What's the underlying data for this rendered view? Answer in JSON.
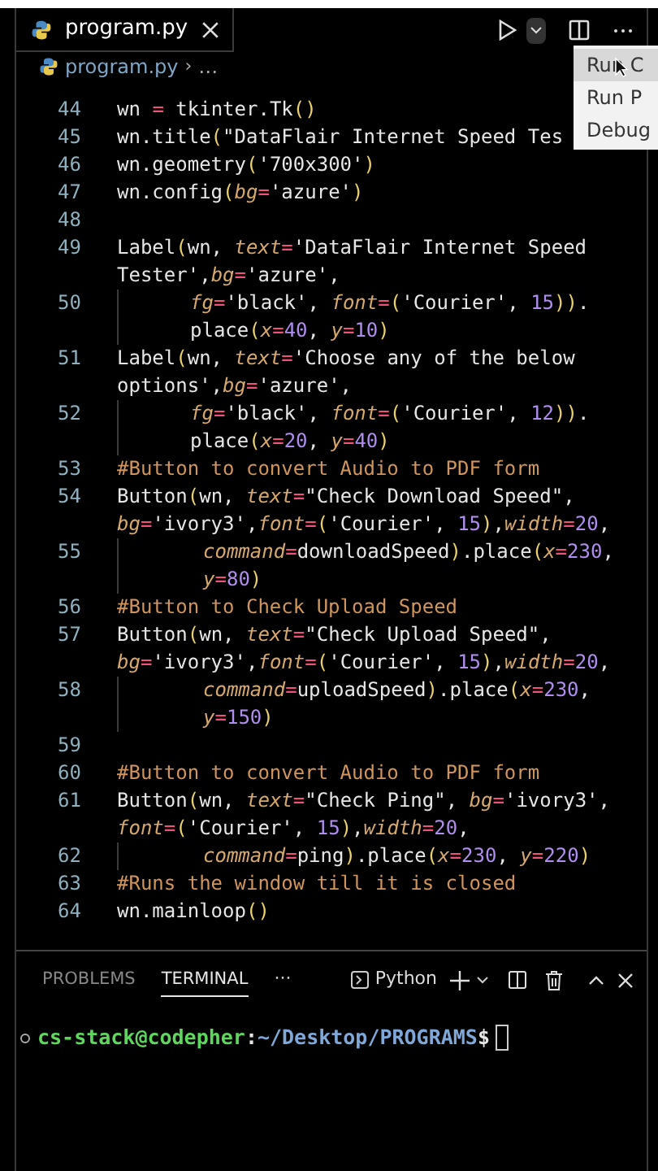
{
  "editor_tab": {
    "label": "program.py",
    "selected": true
  },
  "breadcrumb": {
    "file": "program.py",
    "separator": "›",
    "rest": "…"
  },
  "run_menu": {
    "items": [
      {
        "label": "Run C",
        "selected": true
      },
      {
        "label": "Run P",
        "selected": false
      },
      {
        "label": "Debug",
        "selected": false
      }
    ]
  },
  "code_rows": [
    {
      "number": "44",
      "kind": "line",
      "tokens": [
        {
          "kind": "plain",
          "text": "wn "
        },
        {
          "kind": "operator",
          "text": "="
        },
        {
          "kind": "plain",
          "text": " tkinter.Tk"
        },
        {
          "kind": "bracket",
          "text": "()"
        }
      ]
    },
    {
      "number": "45",
      "kind": "line",
      "tokens": [
        {
          "kind": "plain",
          "text": "wn.title"
        },
        {
          "kind": "bracket",
          "text": "("
        },
        {
          "kind": "string",
          "text": "\"DataFlair Internet Speed Tes"
        }
      ]
    },
    {
      "number": "46",
      "kind": "line",
      "tokens": [
        {
          "kind": "plain",
          "text": "wn.geometry"
        },
        {
          "kind": "bracket",
          "text": "("
        },
        {
          "kind": "string",
          "text": "'700x300'"
        },
        {
          "kind": "bracket",
          "text": ")"
        }
      ]
    },
    {
      "number": "47",
      "kind": "line",
      "tokens": [
        {
          "kind": "plain",
          "text": "wn.config"
        },
        {
          "kind": "bracket",
          "text": "("
        },
        {
          "kind": "keyword",
          "text": "bg"
        },
        {
          "kind": "operator",
          "text": "="
        },
        {
          "kind": "string",
          "text": "'azure'"
        },
        {
          "kind": "bracket",
          "text": ")"
        }
      ]
    },
    {
      "number": "48",
      "kind": "line",
      "tokens": []
    },
    {
      "number": "49",
      "kind": "line",
      "tokens": [
        {
          "kind": "plain",
          "text": "Label"
        },
        {
          "kind": "bracket",
          "text": "("
        },
        {
          "kind": "plain",
          "text": "wn, "
        },
        {
          "kind": "keyword",
          "text": "text"
        },
        {
          "kind": "operator",
          "text": "="
        },
        {
          "kind": "string",
          "text": "'DataFlair Internet Speed"
        }
      ]
    },
    {
      "kind": "wrap",
      "tokens": [
        {
          "kind": "string",
          "text": "Tester'"
        },
        {
          "kind": "plain",
          "text": ","
        },
        {
          "kind": "keyword",
          "text": "bg"
        },
        {
          "kind": "operator",
          "text": "="
        },
        {
          "kind": "string",
          "text": "'azure'"
        },
        {
          "kind": "plain",
          "text": ","
        }
      ]
    },
    {
      "number": "50",
      "kind": "indented",
      "tokens": [
        {
          "kind": "keyword",
          "text": "fg"
        },
        {
          "kind": "operator",
          "text": "="
        },
        {
          "kind": "string",
          "text": "'black'"
        },
        {
          "kind": "plain",
          "text": ", "
        },
        {
          "kind": "keyword",
          "text": "font"
        },
        {
          "kind": "operator",
          "text": "="
        },
        {
          "kind": "bracket",
          "text": "("
        },
        {
          "kind": "string",
          "text": "'Courier'"
        },
        {
          "kind": "plain",
          "text": ", "
        },
        {
          "kind": "number",
          "text": "15"
        },
        {
          "kind": "bracket",
          "text": "))"
        },
        {
          "kind": "plain",
          "text": "."
        }
      ]
    },
    {
      "kind": "indented",
      "tokens": [
        {
          "kind": "plain",
          "text": "place"
        },
        {
          "kind": "bracket",
          "text": "("
        },
        {
          "kind": "keyword",
          "text": "x"
        },
        {
          "kind": "operator",
          "text": "="
        },
        {
          "kind": "number",
          "text": "40"
        },
        {
          "kind": "plain",
          "text": ", "
        },
        {
          "kind": "keyword",
          "text": "y"
        },
        {
          "kind": "operator",
          "text": "="
        },
        {
          "kind": "number",
          "text": "10"
        },
        {
          "kind": "bracket",
          "text": ")"
        }
      ]
    },
    {
      "number": "51",
      "kind": "line",
      "tokens": [
        {
          "kind": "plain",
          "text": "Label"
        },
        {
          "kind": "bracket",
          "text": "("
        },
        {
          "kind": "plain",
          "text": "wn, "
        },
        {
          "kind": "keyword",
          "text": "text"
        },
        {
          "kind": "operator",
          "text": "="
        },
        {
          "kind": "string",
          "text": "'Choose any of the below"
        }
      ]
    },
    {
      "kind": "wrap",
      "tokens": [
        {
          "kind": "string",
          "text": "options'"
        },
        {
          "kind": "plain",
          "text": ","
        },
        {
          "kind": "keyword",
          "text": "bg"
        },
        {
          "kind": "operator",
          "text": "="
        },
        {
          "kind": "string",
          "text": "'azure'"
        },
        {
          "kind": "plain",
          "text": ","
        }
      ]
    },
    {
      "number": "52",
      "kind": "indented",
      "tokens": [
        {
          "kind": "keyword",
          "text": "fg"
        },
        {
          "kind": "operator",
          "text": "="
        },
        {
          "kind": "string",
          "text": "'black'"
        },
        {
          "kind": "plain",
          "text": ", "
        },
        {
          "kind": "keyword",
          "text": "font"
        },
        {
          "kind": "operator",
          "text": "="
        },
        {
          "kind": "bracket",
          "text": "("
        },
        {
          "kind": "string",
          "text": "'Courier'"
        },
        {
          "kind": "plain",
          "text": ", "
        },
        {
          "kind": "number",
          "text": "12"
        },
        {
          "kind": "bracket",
          "text": "))"
        },
        {
          "kind": "plain",
          "text": "."
        }
      ]
    },
    {
      "kind": "indented",
      "tokens": [
        {
          "kind": "plain",
          "text": "place"
        },
        {
          "kind": "bracket",
          "text": "("
        },
        {
          "kind": "keyword",
          "text": "x"
        },
        {
          "kind": "operator",
          "text": "="
        },
        {
          "kind": "number",
          "text": "20"
        },
        {
          "kind": "plain",
          "text": ", "
        },
        {
          "kind": "keyword",
          "text": "y"
        },
        {
          "kind": "operator",
          "text": "="
        },
        {
          "kind": "number",
          "text": "40"
        },
        {
          "kind": "bracket",
          "text": ")"
        }
      ]
    },
    {
      "number": "53",
      "kind": "line",
      "tokens": [
        {
          "kind": "comment",
          "text": "#Button to convert Audio to PDF form"
        }
      ]
    },
    {
      "number": "54",
      "kind": "line",
      "tokens": [
        {
          "kind": "plain",
          "text": "Button"
        },
        {
          "kind": "bracket",
          "text": "("
        },
        {
          "kind": "plain",
          "text": "wn, "
        },
        {
          "kind": "keyword",
          "text": "text"
        },
        {
          "kind": "operator",
          "text": "="
        },
        {
          "kind": "string",
          "text": "\"Check Download Speed\""
        },
        {
          "kind": "plain",
          "text": ","
        }
      ]
    },
    {
      "kind": "wrap",
      "tokens": [
        {
          "kind": "keyword",
          "text": "bg"
        },
        {
          "kind": "operator",
          "text": "="
        },
        {
          "kind": "string",
          "text": "'ivory3'"
        },
        {
          "kind": "plain",
          "text": ","
        },
        {
          "kind": "keyword",
          "text": "font"
        },
        {
          "kind": "operator",
          "text": "="
        },
        {
          "kind": "bracket",
          "text": "("
        },
        {
          "kind": "string",
          "text": "'Courier'"
        },
        {
          "kind": "plain",
          "text": ", "
        },
        {
          "kind": "number",
          "text": "15"
        },
        {
          "kind": "bracket",
          "text": ")"
        },
        {
          "kind": "plain",
          "text": ","
        },
        {
          "kind": "keyword",
          "text": "width"
        },
        {
          "kind": "operator",
          "text": "="
        },
        {
          "kind": "number",
          "text": "20"
        },
        {
          "kind": "plain",
          "text": ","
        }
      ]
    },
    {
      "number": "55",
      "kind": "deep",
      "tokens": [
        {
          "kind": "keyword",
          "text": "command"
        },
        {
          "kind": "operator",
          "text": "="
        },
        {
          "kind": "plain",
          "text": "downloadSpeed"
        },
        {
          "kind": "bracket",
          "text": ")"
        },
        {
          "kind": "plain",
          "text": ".place"
        },
        {
          "kind": "bracket",
          "text": "("
        },
        {
          "kind": "keyword",
          "text": "x"
        },
        {
          "kind": "operator",
          "text": "="
        },
        {
          "kind": "number",
          "text": "230"
        },
        {
          "kind": "plain",
          "text": ","
        }
      ]
    },
    {
      "kind": "deep",
      "tokens": [
        {
          "kind": "keyword",
          "text": "y"
        },
        {
          "kind": "operator",
          "text": "="
        },
        {
          "kind": "number",
          "text": "80"
        },
        {
          "kind": "bracket",
          "text": ")"
        }
      ]
    },
    {
      "number": "56",
      "kind": "line",
      "tokens": [
        {
          "kind": "comment",
          "text": "#Button to Check Upload Speed"
        }
      ]
    },
    {
      "number": "57",
      "kind": "line",
      "tokens": [
        {
          "kind": "plain",
          "text": "Button"
        },
        {
          "kind": "bracket",
          "text": "("
        },
        {
          "kind": "plain",
          "text": "wn, "
        },
        {
          "kind": "keyword",
          "text": "text"
        },
        {
          "kind": "operator",
          "text": "="
        },
        {
          "kind": "string",
          "text": "\"Check Upload Speed\""
        },
        {
          "kind": "plain",
          "text": ","
        }
      ]
    },
    {
      "kind": "wrap",
      "tokens": [
        {
          "kind": "keyword",
          "text": "bg"
        },
        {
          "kind": "operator",
          "text": "="
        },
        {
          "kind": "string",
          "text": "'ivory3'"
        },
        {
          "kind": "plain",
          "text": ","
        },
        {
          "kind": "keyword",
          "text": "font"
        },
        {
          "kind": "operator",
          "text": "="
        },
        {
          "kind": "bracket",
          "text": "("
        },
        {
          "kind": "string",
          "text": "'Courier'"
        },
        {
          "kind": "plain",
          "text": ", "
        },
        {
          "kind": "number",
          "text": "15"
        },
        {
          "kind": "bracket",
          "text": ")"
        },
        {
          "kind": "plain",
          "text": ","
        },
        {
          "kind": "keyword",
          "text": "width"
        },
        {
          "kind": "operator",
          "text": "="
        },
        {
          "kind": "number",
          "text": "20"
        },
        {
          "kind": "plain",
          "text": ","
        }
      ]
    },
    {
      "number": "58",
      "kind": "deep",
      "tokens": [
        {
          "kind": "keyword",
          "text": "command"
        },
        {
          "kind": "operator",
          "text": "="
        },
        {
          "kind": "plain",
          "text": "uploadSpeed"
        },
        {
          "kind": "bracket",
          "text": ")"
        },
        {
          "kind": "plain",
          "text": ".place"
        },
        {
          "kind": "bracket",
          "text": "("
        },
        {
          "kind": "keyword",
          "text": "x"
        },
        {
          "kind": "operator",
          "text": "="
        },
        {
          "kind": "number",
          "text": "230"
        },
        {
          "kind": "plain",
          "text": ","
        }
      ]
    },
    {
      "kind": "deep",
      "tokens": [
        {
          "kind": "keyword",
          "text": "y"
        },
        {
          "kind": "operator",
          "text": "="
        },
        {
          "kind": "number",
          "text": "150"
        },
        {
          "kind": "bracket",
          "text": ")"
        }
      ]
    },
    {
      "number": "59",
      "kind": "line",
      "tokens": []
    },
    {
      "number": "60",
      "kind": "line",
      "tokens": [
        {
          "kind": "comment",
          "text": "#Button to convert Audio to PDF form"
        }
      ]
    },
    {
      "number": "61",
      "kind": "line",
      "tokens": [
        {
          "kind": "plain",
          "text": "Button"
        },
        {
          "kind": "bracket",
          "text": "("
        },
        {
          "kind": "plain",
          "text": "wn, "
        },
        {
          "kind": "keyword",
          "text": "text"
        },
        {
          "kind": "operator",
          "text": "="
        },
        {
          "kind": "string",
          "text": "\"Check Ping\""
        },
        {
          "kind": "plain",
          "text": ", "
        },
        {
          "kind": "keyword",
          "text": "bg"
        },
        {
          "kind": "operator",
          "text": "="
        },
        {
          "kind": "string",
          "text": "'ivory3'"
        },
        {
          "kind": "plain",
          "text": ","
        }
      ]
    },
    {
      "kind": "wrap",
      "tokens": [
        {
          "kind": "keyword",
          "text": "font"
        },
        {
          "kind": "operator",
          "text": "="
        },
        {
          "kind": "bracket",
          "text": "("
        },
        {
          "kind": "string",
          "text": "'Courier'"
        },
        {
          "kind": "plain",
          "text": ", "
        },
        {
          "kind": "number",
          "text": "15"
        },
        {
          "kind": "bracket",
          "text": ")"
        },
        {
          "kind": "plain",
          "text": ","
        },
        {
          "kind": "keyword",
          "text": "width"
        },
        {
          "kind": "operator",
          "text": "="
        },
        {
          "kind": "number",
          "text": "20"
        },
        {
          "kind": "plain",
          "text": ","
        }
      ]
    },
    {
      "number": "62",
      "kind": "deep",
      "tokens": [
        {
          "kind": "keyword",
          "text": "command"
        },
        {
          "kind": "operator",
          "text": "="
        },
        {
          "kind": "plain",
          "text": "ping"
        },
        {
          "kind": "bracket",
          "text": ")"
        },
        {
          "kind": "plain",
          "text": ".place"
        },
        {
          "kind": "bracket",
          "text": "("
        },
        {
          "kind": "keyword",
          "text": "x"
        },
        {
          "kind": "operator",
          "text": "="
        },
        {
          "kind": "number",
          "text": "230"
        },
        {
          "kind": "plain",
          "text": ", "
        },
        {
          "kind": "keyword",
          "text": "y"
        },
        {
          "kind": "operator",
          "text": "="
        },
        {
          "kind": "number",
          "text": "220"
        },
        {
          "kind": "bracket",
          "text": ")"
        }
      ]
    },
    {
      "number": "63",
      "kind": "line",
      "tokens": [
        {
          "kind": "comment",
          "text": "#Runs the window till it is closed"
        }
      ]
    },
    {
      "number": "64",
      "kind": "line",
      "tokens": [
        {
          "kind": "plain",
          "text": "wn.mainloop"
        },
        {
          "kind": "bracket",
          "text": "()"
        }
      ]
    }
  ],
  "panel_tabs": [
    {
      "label": "PROBLEMS",
      "selected": false
    },
    {
      "label": "TERMINAL",
      "selected": true
    }
  ],
  "panel_more": "···",
  "terminal_profile": "Python",
  "terminal": {
    "user": "cs-stack@codepher",
    "sep": ":",
    "path": "~/Desktop/PROGRAMS",
    "prompt": "$"
  }
}
